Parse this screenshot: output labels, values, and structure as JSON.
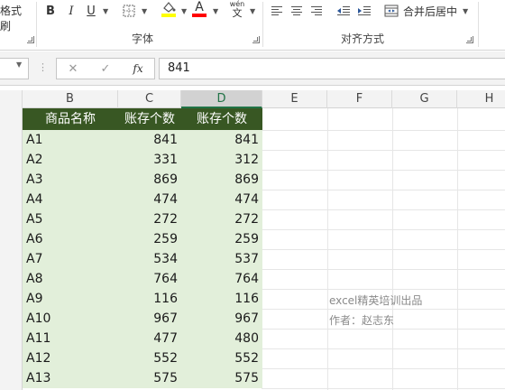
{
  "ribbon": {
    "cell_styles_fragment": "格式刷",
    "bold": "B",
    "italic": "I",
    "underline": "U",
    "font_color_glyph": "A",
    "phonetic_glyph": "文",
    "phonetic_ruby": "wén",
    "merge_center_label": "合并后居中",
    "font_group_label": "字体",
    "align_group_label": "对齐方式",
    "font_color_accent": "#ff0000",
    "fill_color_accent": "#ffff00"
  },
  "formula_bar": {
    "cancel_glyph": "✕",
    "enter_glyph": "✓",
    "fx_glyph": "fx",
    "value": "841"
  },
  "columns": [
    "B",
    "C",
    "D",
    "E",
    "F",
    "G",
    "H"
  ],
  "table": {
    "headers": [
      "商品名称",
      "账存个数",
      "账存个数"
    ],
    "rows": [
      [
        "A1",
        "841",
        "841"
      ],
      [
        "A2",
        "331",
        "312"
      ],
      [
        "A3",
        "869",
        "869"
      ],
      [
        "A4",
        "474",
        "474"
      ],
      [
        "A5",
        "272",
        "272"
      ],
      [
        "A6",
        "259",
        "259"
      ],
      [
        "A7",
        "534",
        "537"
      ],
      [
        "A8",
        "764",
        "764"
      ],
      [
        "A9",
        "116",
        "116"
      ],
      [
        "A10",
        "967",
        "967"
      ],
      [
        "A11",
        "477",
        "480"
      ],
      [
        "A12",
        "552",
        "552"
      ],
      [
        "A13",
        "575",
        "575"
      ]
    ],
    "header_color": "#385723",
    "data_fill": "#e2efda"
  },
  "note": {
    "line1": "excel精英培训出品",
    "line2": "作者：赵志东"
  }
}
